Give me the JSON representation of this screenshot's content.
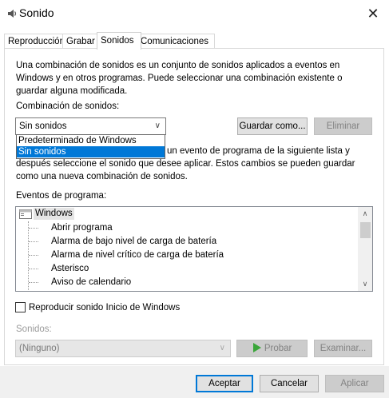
{
  "window": {
    "title": "Sonido",
    "close_glyph": "✕"
  },
  "tabs": [
    {
      "label": "Reproducción"
    },
    {
      "label": "Grabar"
    },
    {
      "label": "Sonidos"
    },
    {
      "label": "Comunicaciones"
    }
  ],
  "intro_text": "Una combinación de sonidos es un conjunto de sonidos aplicados a eventos en Windows y en otros programas. Puede seleccionar una combinación existente o guardar alguna modificada.",
  "scheme": {
    "label": "Combinación de sonidos:",
    "selected_value": "Sin sonidos",
    "options": [
      "Predeterminado de Windows",
      "Sin sonidos"
    ],
    "save_as_label": "Guardar como...",
    "delete_label": "Eliminar"
  },
  "instruction_text_tail": "un evento de programa de la siguiente lista y",
  "instruction_text_rest": "después seleccione el sonido que desee aplicar. Estos cambios se pueden guardar como una nueva combinación de sonidos.",
  "events": {
    "label": "Eventos de programa:",
    "root": "Windows",
    "items": [
      "Abrir programa",
      "Alarma de bajo nivel de carga de batería",
      "Alarma de nivel crítico de carga de batería",
      "Asterisco",
      "Aviso de calendario"
    ]
  },
  "startup_sound": {
    "label": "Reproducir sonido Inicio de Windows",
    "checked": false
  },
  "sounds": {
    "label": "Sonidos:",
    "selected_value": "(Ninguno)",
    "test_label": "Probar",
    "browse_label": "Examinar..."
  },
  "footer": {
    "ok_label": "Aceptar",
    "cancel_label": "Cancelar",
    "apply_label": "Aplicar"
  },
  "colors": {
    "selection": "#0078d7",
    "play_icon": "#3aa63a"
  }
}
